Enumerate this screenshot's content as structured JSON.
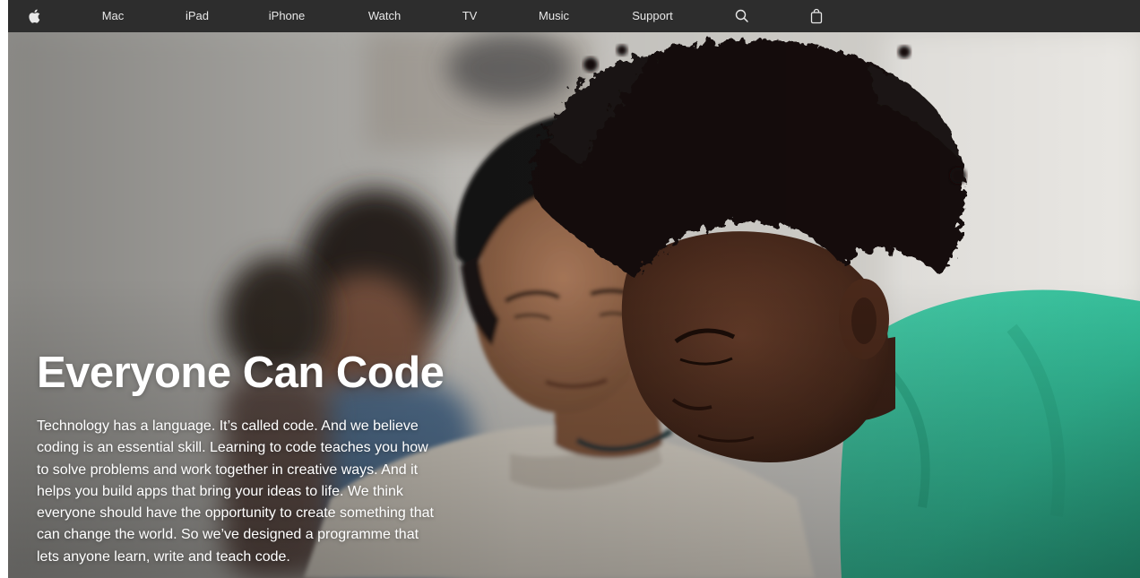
{
  "nav": {
    "logo_icon": "apple-logo-icon",
    "items": [
      {
        "label": "Mac"
      },
      {
        "label": "iPad"
      },
      {
        "label": "iPhone"
      },
      {
        "label": "Watch"
      },
      {
        "label": "TV"
      },
      {
        "label": "Music"
      },
      {
        "label": "Support"
      }
    ],
    "search_icon": "search-icon",
    "bag_icon": "shopping-bag-icon"
  },
  "hero": {
    "title": "Everyone Can Code",
    "body": "Technology has a language. It’s called code. And we believe coding is an essential skill. Learning to code teaches you how to solve problems and work together in creative ways. And it helps you build apps that bring your ideas to life. We think everyone should have the opportunity to create something that can change the world. So we’ve designed a programme that lets anyone learn, write and teach code.",
    "image": "students-learning-to-code-photo"
  },
  "colors": {
    "nav_background": "#2d2d2d",
    "nav_text": "#e8e8e8",
    "hero_text": "#ffffff",
    "shirt_teal": "#3ec9a4"
  }
}
